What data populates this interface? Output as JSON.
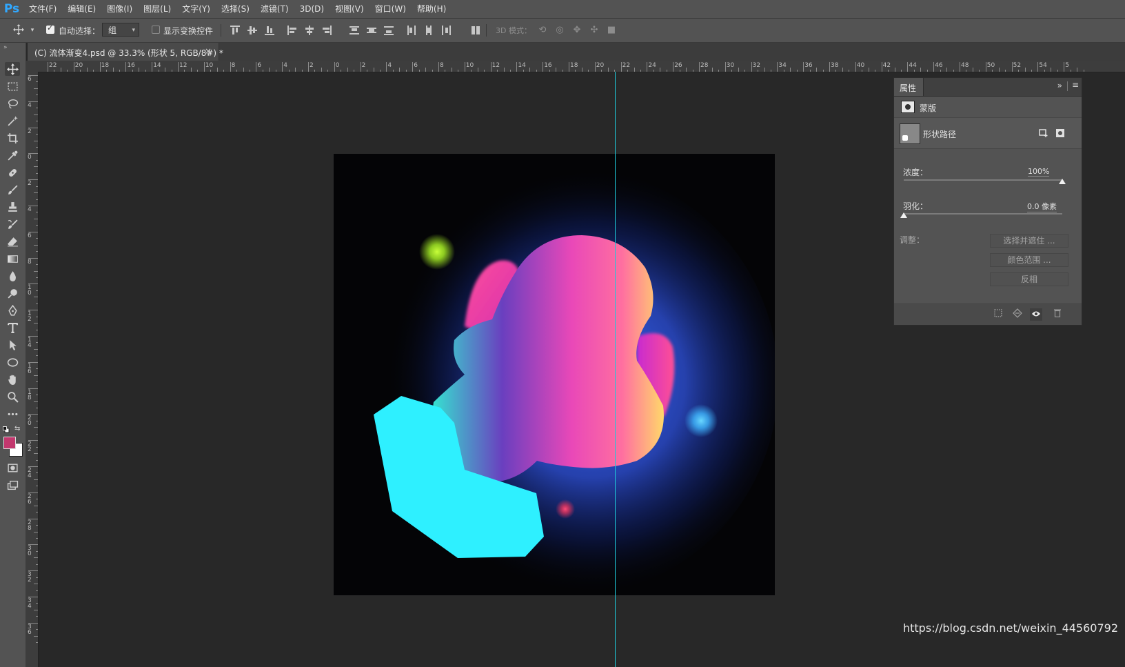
{
  "app": {
    "logo": "Ps",
    "menu": [
      "文件(F)",
      "编辑(E)",
      "图像(I)",
      "图层(L)",
      "文字(Y)",
      "选择(S)",
      "滤镜(T)",
      "3D(D)",
      "视图(V)",
      "窗口(W)",
      "帮助(H)"
    ]
  },
  "options_bar": {
    "auto_select_label": "自动选择：",
    "auto_select_checked": true,
    "auto_select_value": "组",
    "show_transform_label": "显示变换控件",
    "show_transform_checked": false,
    "mode_3d_label": "3D 模式："
  },
  "document_tab": {
    "title": "(C) 流体渐变4.psd @ 33.3% (形状 5, RGB/8#) *",
    "close": "×"
  },
  "rulers": {
    "top": [
      "22",
      "20",
      "18",
      "16",
      "14",
      "12",
      "10",
      "8",
      "6",
      "4",
      "2",
      "0",
      "2",
      "4",
      "6",
      "8",
      "10",
      "12",
      "14",
      "16",
      "18",
      "20",
      "22",
      "24",
      "26",
      "28",
      "30",
      "32",
      "34",
      "36",
      "38",
      "40",
      "42",
      "44",
      "46",
      "48",
      "50",
      "52",
      "54",
      "5"
    ],
    "left": [
      "6",
      "4",
      "2",
      "0",
      "2",
      "4",
      "6",
      "8",
      "10",
      "12",
      "14",
      "16",
      "18",
      "20",
      "22",
      "24",
      "26",
      "28",
      "30",
      "32",
      "34",
      "36"
    ]
  },
  "properties": {
    "tab": "属性",
    "collapse": "»",
    "menu": "≡",
    "mask_label": "蒙版",
    "shape_path_label": "形状路径",
    "density_label": "浓度：",
    "density_value": "100%",
    "density_fraction": 1.0,
    "feather_label": "羽化：",
    "feather_value": "0.0 像素",
    "feather_fraction": 0.0,
    "adjust_label": "调整：",
    "buttons": [
      "选择并遮住 ...",
      "颜色范围 ...",
      "反相"
    ]
  },
  "colors": {
    "foreground": "#c2386e",
    "background": "#ffffff",
    "guide": "#1ec8d8",
    "cyan_shape": "#2ef0ff"
  },
  "watermark": "https://blog.csdn.net/weixin_44560792"
}
